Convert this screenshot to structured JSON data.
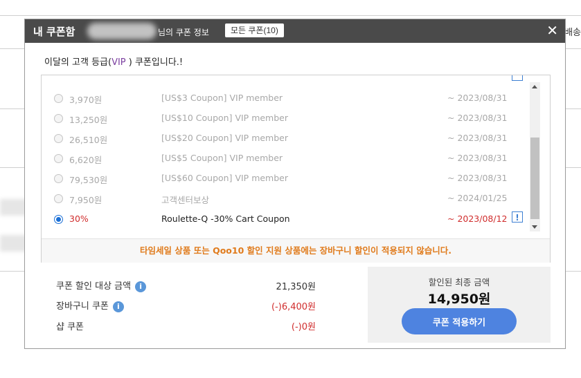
{
  "background": {
    "right_text": "배송"
  },
  "modal": {
    "title": "내 쿠폰함",
    "subtitle": "님의 쿠폰 정보",
    "all_coupons_button": "모든 쿠폰(10)",
    "close_label": "✕"
  },
  "grade": {
    "prefix": "이달의 고객 등급(",
    "vip": "VIP",
    "suffix": " ) 쿠폰입니다.!"
  },
  "coupons": [
    {
      "amount": "3,970원",
      "name": "[US$3 Coupon] VIP member",
      "expiry": "~ 2023/08/31"
    },
    {
      "amount": "13,250원",
      "name": "[US$10 Coupon] VIP member",
      "expiry": "~ 2023/08/31"
    },
    {
      "amount": "26,510원",
      "name": "[US$20 Coupon] VIP member",
      "expiry": "~ 2023/08/31"
    },
    {
      "amount": "6,620원",
      "name": "[US$5 Coupon] VIP member",
      "expiry": "~ 2023/08/31"
    },
    {
      "amount": "79,530원",
      "name": "[US$60 Coupon] VIP member",
      "expiry": "~ 2023/08/31"
    },
    {
      "amount": "7,950원",
      "name": "고객센터보상",
      "expiry": "~ 2024/01/25"
    },
    {
      "amount": "30%",
      "name": "Roulette-Q -30% Cart Coupon",
      "expiry": "~ 2023/08/12",
      "info": "!"
    }
  ],
  "warning": "타임세일 상품 또는 Qoo10 할인 지원 상품에는 장바구니 할인이 적용되지 않습니다.",
  "summary": {
    "target_label": "쿠폰 할인 대상 금액",
    "target_value": "21,350원",
    "cart_label": "장바구니 쿠폰",
    "cart_value": "(-)6,400원",
    "shop_label": "샵 쿠폰",
    "shop_value": "(-)0원",
    "info_glyph": "i"
  },
  "final": {
    "label": "할인된 최종 금액",
    "amount": "14,950원",
    "apply_button": "쿠폰 적용하기"
  },
  "colors": {
    "header_bg": "#4a4a4a",
    "accent_red": "#d02c2c",
    "warning_orange": "#e07b1c",
    "apply_blue": "#4e83e0",
    "vip_purple": "#7b3fa0"
  }
}
